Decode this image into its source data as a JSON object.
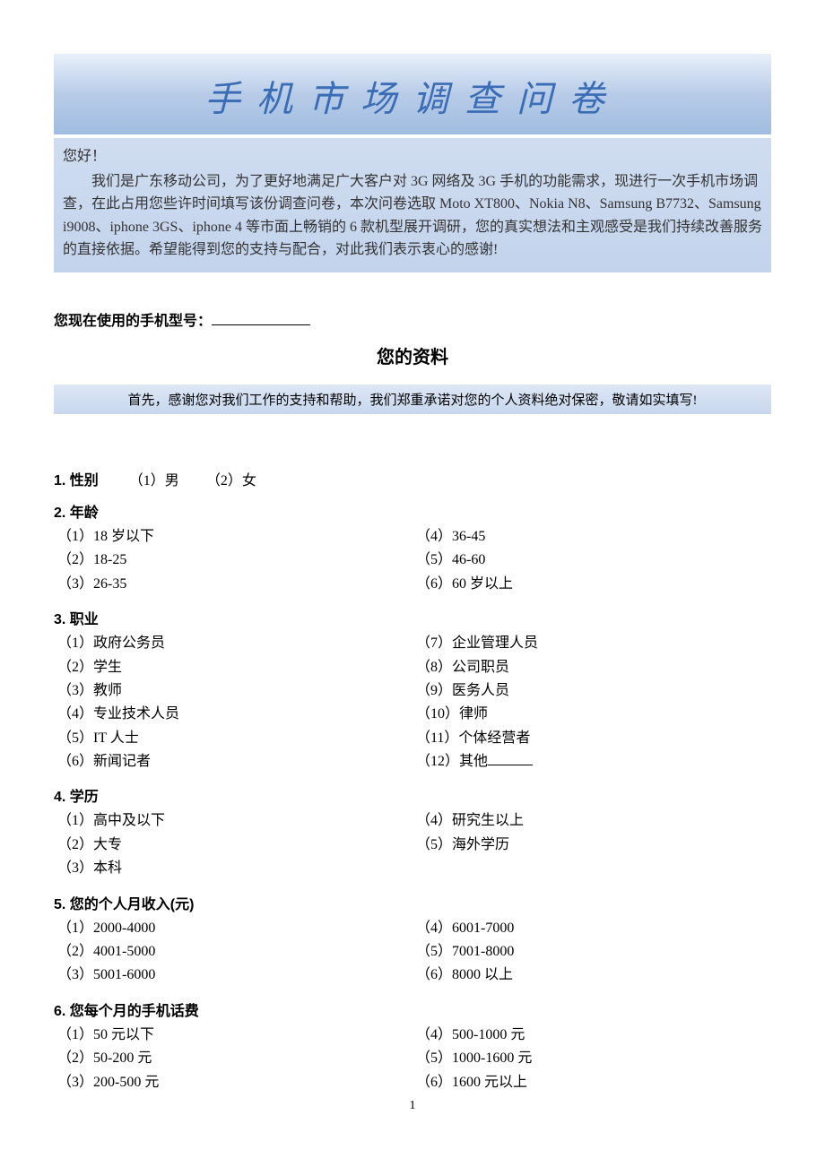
{
  "header": {
    "main_title": "手机市场调查问卷"
  },
  "intro": {
    "greet": "您好！",
    "body": "我们是广东移动公司，为了更好地满足广大客户对 3G 网络及 3G 手机的功能需求，现进行一次手机市场调查，在此占用您些许时间填写该份调查问卷，本次问卷选取 Moto XT800、Nokia N8、Samsung B7732、Samsung i9008、iphone 3GS、iphone 4 等市面上畅销的 6 款机型展开调研，您的真实想法和主观感受是我们持续改善服务的直接依据。希望能得到您的支持与配合，对此我们表示衷心的感谢!"
  },
  "model_line": "您现在使用的手机型号：",
  "section_title": "您的资料",
  "notice": "首先，感谢您对我们工作的支持和帮助，我们郑重承诺对您的个人资料绝对保密，敬请如实填写!",
  "q1": {
    "title": "1.  性别",
    "opt1": "（1）男",
    "opt2": "（2）女"
  },
  "q2": {
    "title": "2.  年龄",
    "left": [
      "（1）18 岁以下",
      "（2）18-25",
      "（3）26-35"
    ],
    "right": [
      "（4）36-45",
      "（5）46-60",
      "（6）60 岁以上"
    ]
  },
  "q3": {
    "title": "3.  职业",
    "left": [
      "（1）政府公务员",
      "（2）学生",
      "（3）教师",
      "（4）专业技术人员",
      "（5）IT 人士",
      "（6）新闻记者"
    ],
    "right": [
      "（7）企业管理人员",
      "（8）公司职员",
      "（9）医务人员",
      "（10）律师",
      "（11）个体经营者",
      "（12）其他"
    ]
  },
  "q4": {
    "title": "4.  学历",
    "left": [
      "（1）高中及以下",
      "（2）大专",
      "（3）本科"
    ],
    "right": [
      "（4）研究生以上",
      "（5）海外学历"
    ]
  },
  "q5": {
    "title": "5.  您的个人月收入(元)",
    "left": [
      "（1）2000-4000",
      "（2）4001-5000",
      "（3）5001-6000"
    ],
    "right": [
      "（4）6001-7000",
      "（5）7001-8000",
      "（6）8000 以上"
    ]
  },
  "q6": {
    "title": "6.  您每个月的手机话费",
    "left": [
      "（1）50 元以下",
      "（2）50-200 元",
      "（3）200-500 元"
    ],
    "right": [
      "（4）500-1000 元",
      "（5）1000-1600 元",
      "（6）1600 元以上"
    ]
  },
  "page_num": "1"
}
